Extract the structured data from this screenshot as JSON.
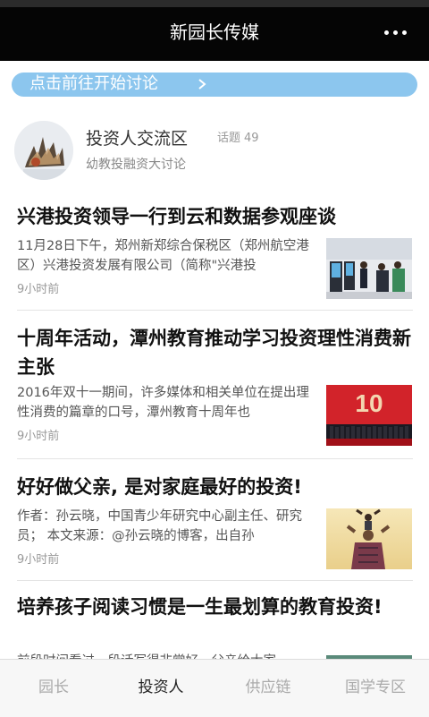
{
  "header": {
    "title": "新园长传媒",
    "more_icon": "more-dots-icon"
  },
  "banner": {
    "label": "点击前往开始讨论",
    "icon": "chevron-right-icon"
  },
  "community": {
    "name": "投资人交流区",
    "topics_label": "话题",
    "topics_count": "49",
    "description": "幼教投融资大讨论"
  },
  "articles": [
    {
      "title": "兴港投资领导一行到云和数据参观座谈",
      "excerpt": "11月28日下午，郑州新郑综合保税区（郑州航空港区）兴港投资发展有限公司（简称\"兴港投",
      "time": "9小时前"
    },
    {
      "title": "十周年活动，潭州教育推动学习投资理性消费新主张",
      "excerpt": "2016年双十一期间，许多媒体和相关单位在提出理性消费的篇章的口号，潭州教育十周年也",
      "time": "9小时前",
      "thumb_text": "10"
    },
    {
      "title": "好好做父亲, 是对家庭最好的投资!",
      "excerpt": "作者：孙云晓，中国青少年研究中心副主任、研究员；  本文来源：@孙云晓的博客，出自孙",
      "time": "9小时前"
    },
    {
      "title": "培养孩子阅读习惯是一生最划算的教育投资!",
      "excerpt": "前段时间看过一段话写得非常好，父亲给大家",
      "time": ""
    }
  ],
  "tabs": [
    {
      "label": "园长",
      "active": false
    },
    {
      "label": "投资人",
      "active": true
    },
    {
      "label": "供应链",
      "active": false
    },
    {
      "label": "国学专区",
      "active": false
    }
  ],
  "colors": {
    "topbar": "#050505",
    "banner": "#8cc6ee",
    "accent_red": "#d2232a"
  }
}
